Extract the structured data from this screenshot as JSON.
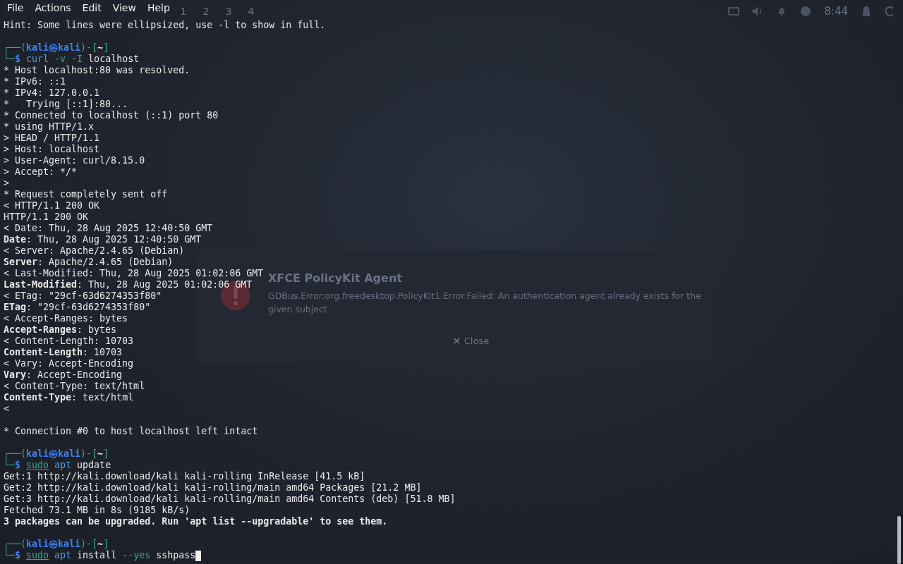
{
  "desktop": {
    "workspaces": [
      {
        "label": "1",
        "selected": false
      },
      {
        "label": "2",
        "selected": false
      },
      {
        "label": "3",
        "selected": false
      },
      {
        "label": "4",
        "selected": false
      }
    ],
    "clock": "8:44",
    "dialog": {
      "title": "XFCE PolicyKit Agent",
      "message": "GDBus.Error:org.freedesktop.PolicyKit1.Error.Failed: An authentication agent already exists for the given subject",
      "button": "Close"
    }
  },
  "menu": [
    "File",
    "Actions",
    "Edit",
    "View",
    "Help"
  ],
  "lines": [
    {
      "kind": "plain",
      "text": "Hint: Some lines were ellipsized, use -l to show in full."
    },
    {
      "kind": "blank"
    },
    {
      "kind": "prompt",
      "segments": [
        {
          "t": "┌──(",
          "kind": "frame"
        },
        {
          "t": "kali㉿kali",
          "kind": "user"
        },
        {
          "t": ")-[",
          "kind": "frame"
        },
        {
          "t": "~",
          "kind": "dir"
        },
        {
          "t": "]",
          "kind": "frame"
        }
      ]
    },
    {
      "kind": "command",
      "segments": [
        {
          "t": "└─",
          "kind": "frame"
        },
        {
          "t": "$ ",
          "kind": "user"
        },
        {
          "t": "curl",
          "kind": "program"
        },
        {
          "t": " -v -I",
          "kind": "option"
        },
        {
          "t": " localhost",
          "kind": "arg"
        }
      ]
    },
    {
      "kind": "plain",
      "text": "* Host localhost:80 was resolved."
    },
    {
      "kind": "plain",
      "text": "* IPv6: ::1"
    },
    {
      "kind": "plain",
      "text": "* IPv4: 127.0.0.1"
    },
    {
      "kind": "plain",
      "text": "*   Trying [::1]:80..."
    },
    {
      "kind": "plain",
      "text": "* Connected to localhost (::1) port 80"
    },
    {
      "kind": "plain",
      "text": "* using HTTP/1.x"
    },
    {
      "kind": "plain",
      "text": "> HEAD / HTTP/1.1"
    },
    {
      "kind": "plain",
      "text": "> Host: localhost"
    },
    {
      "kind": "plain",
      "text": "> User-Agent: curl/8.15.0"
    },
    {
      "kind": "plain",
      "text": "> Accept: */*"
    },
    {
      "kind": "plain",
      "text": ">"
    },
    {
      "kind": "plain",
      "text": "* Request completely sent off"
    },
    {
      "kind": "plain",
      "text": "< HTTP/1.1 200 OK"
    },
    {
      "kind": "plain",
      "text": "HTTP/1.1 200 OK"
    },
    {
      "kind": "plain",
      "text": "< Date: Thu, 28 Aug 2025 12:40:50 GMT"
    },
    {
      "kind": "rich",
      "text": "**Date**: Thu, 28 Aug 2025 12:40:50 GMT"
    },
    {
      "kind": "plain",
      "text": "< Server: Apache/2.4.65 (Debian)"
    },
    {
      "kind": "rich",
      "text": "**Server**: Apache/2.4.65 (Debian)"
    },
    {
      "kind": "plain",
      "text": "< Last-Modified: Thu, 28 Aug 2025 01:02:06 GMT"
    },
    {
      "kind": "rich",
      "text": "**Last-Modified**: Thu, 28 Aug 2025 01:02:06 GMT"
    },
    {
      "kind": "plain",
      "text": "< ETag: \"29cf-63d6274353f80\""
    },
    {
      "kind": "rich",
      "text": "**ETag**: \"29cf-63d6274353f80\""
    },
    {
      "kind": "plain",
      "text": "< Accept-Ranges: bytes"
    },
    {
      "kind": "rich",
      "text": "**Accept-Ranges**: bytes"
    },
    {
      "kind": "plain",
      "text": "< Content-Length: 10703"
    },
    {
      "kind": "rich",
      "text": "**Content-Length**: 10703"
    },
    {
      "kind": "plain",
      "text": "< Vary: Accept-Encoding"
    },
    {
      "kind": "rich",
      "text": "**Vary**: Accept-Encoding"
    },
    {
      "kind": "plain",
      "text": "< Content-Type: text/html"
    },
    {
      "kind": "rich",
      "text": "**Content-Type**: text/html"
    },
    {
      "kind": "plain",
      "text": "<"
    },
    {
      "kind": "blank"
    },
    {
      "kind": "plain",
      "text": "* Connection #0 to host localhost left intact"
    },
    {
      "kind": "blank"
    },
    {
      "kind": "prompt",
      "segments": [
        {
          "t": "┌──(",
          "kind": "frame"
        },
        {
          "t": "kali㉿kali",
          "kind": "user"
        },
        {
          "t": ")-[",
          "kind": "frame"
        },
        {
          "t": "~",
          "kind": "dir"
        },
        {
          "t": "]",
          "kind": "frame"
        }
      ]
    },
    {
      "kind": "command",
      "segments": [
        {
          "t": "└─",
          "kind": "frame"
        },
        {
          "t": "$ ",
          "kind": "user"
        },
        {
          "t": "sudo",
          "kind": "sudo"
        },
        {
          "t": " apt",
          "kind": "program"
        },
        {
          "t": " update",
          "kind": "arg"
        }
      ]
    },
    {
      "kind": "plain",
      "text": "Get:1 http://kali.download/kali kali-rolling InRelease [41.5 kB]"
    },
    {
      "kind": "plain",
      "text": "Get:2 http://kali.download/kali kali-rolling/main amd64 Packages [21.2 MB]"
    },
    {
      "kind": "plain",
      "text": "Get:3 http://kali.download/kali kali-rolling/main amd64 Contents (deb) [51.8 MB]"
    },
    {
      "kind": "plain",
      "text": "Fetched 73.1 MB in 8s (9185 kB/s)"
    },
    {
      "kind": "bold",
      "text": "3 packages can be upgraded. Run 'apt list --upgradable' to see them."
    },
    {
      "kind": "blank"
    },
    {
      "kind": "prompt",
      "segments": [
        {
          "t": "┌──(",
          "kind": "frame"
        },
        {
          "t": "kali㉿kali",
          "kind": "user"
        },
        {
          "t": ")-[",
          "kind": "frame"
        },
        {
          "t": "~",
          "kind": "dir"
        },
        {
          "t": "]",
          "kind": "frame"
        }
      ]
    },
    {
      "kind": "command",
      "cursor": true,
      "segments": [
        {
          "t": "└─",
          "kind": "frame"
        },
        {
          "t": "$ ",
          "kind": "user"
        },
        {
          "t": "sudo",
          "kind": "sudo"
        },
        {
          "t": " apt",
          "kind": "program"
        },
        {
          "t": " install",
          "kind": "arg"
        },
        {
          "t": " --yes",
          "kind": "option"
        },
        {
          "t": " sshpass",
          "kind": "arg"
        }
      ]
    }
  ]
}
